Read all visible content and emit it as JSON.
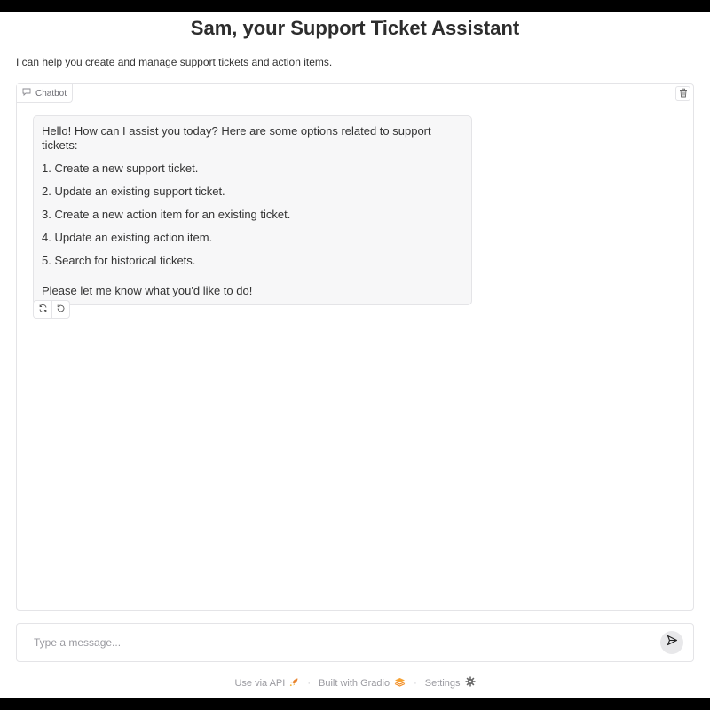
{
  "header": {
    "title": "Sam, your Support Ticket Assistant",
    "description": "I can help you create and manage support tickets and action items."
  },
  "chatbot": {
    "label": "Chatbot",
    "messages": [
      {
        "role": "assistant",
        "intro": "Hello! How can I assist you today? Here are some options related to support tickets:",
        "options": [
          "1. Create a new support ticket.",
          "2. Update an existing support ticket.",
          "3. Create a new action item for an existing ticket.",
          "4. Update an existing action item.",
          "5. Search for historical tickets."
        ],
        "closing": "Please let me know what you'd like to do!"
      }
    ]
  },
  "input": {
    "placeholder": "Type a message...",
    "value": ""
  },
  "footer": {
    "api_label": "Use via API",
    "built_label": "Built with Gradio",
    "settings_label": "Settings"
  },
  "icons": {
    "chat_label": "chat-icon",
    "clear": "trash-icon",
    "retry": "retry-icon",
    "undo": "undo-icon",
    "send": "send-icon",
    "api": "rocket-icon",
    "gradio": "gradio-logo-icon",
    "settings": "gear-icon"
  }
}
